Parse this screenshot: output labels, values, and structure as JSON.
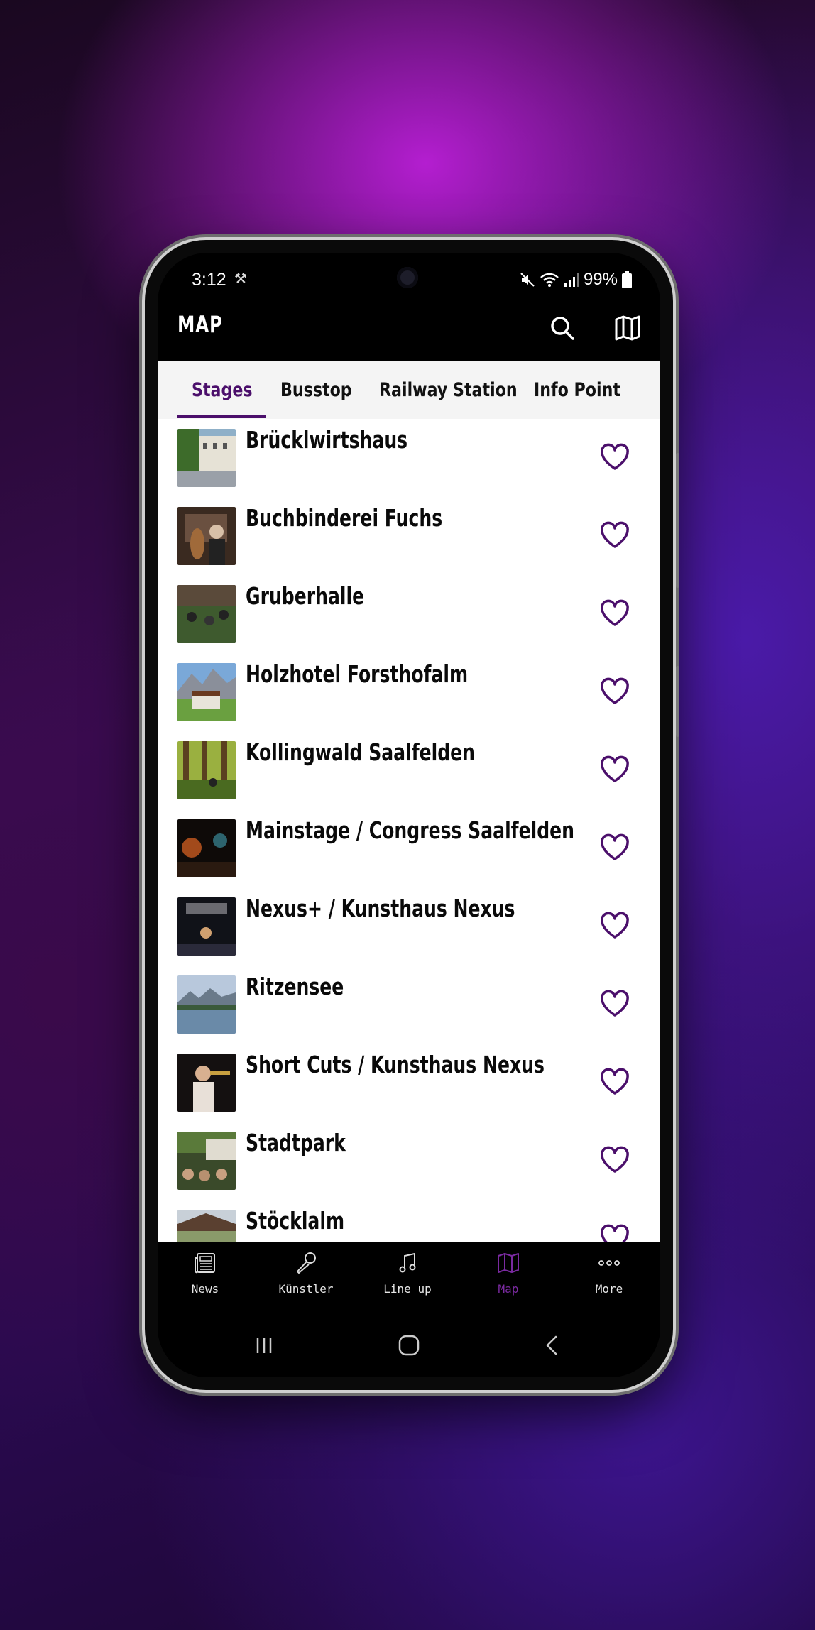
{
  "status": {
    "time": "3:12",
    "battery": "99%"
  },
  "appbar": {
    "title": "MAP"
  },
  "tabs": [
    {
      "label": "Stages",
      "active": true
    },
    {
      "label": "Busstop",
      "active": false
    },
    {
      "label": "Railway Station",
      "active": false
    },
    {
      "label": "Info Point",
      "active": false
    }
  ],
  "stages": [
    {
      "name": "Brücklwirtshaus"
    },
    {
      "name": "Buchbinderei Fuchs"
    },
    {
      "name": "Gruberhalle"
    },
    {
      "name": "Holzhotel Forsthofalm"
    },
    {
      "name": "Kollingwald Saalfelden"
    },
    {
      "name": "Mainstage / Congress Saalfelden"
    },
    {
      "name": "Nexus+ / Kunsthaus Nexus"
    },
    {
      "name": "Ritzensee"
    },
    {
      "name": "Short Cuts / Kunsthaus Nexus"
    },
    {
      "name": "Stadtpark"
    },
    {
      "name": "Stöcklalm"
    }
  ],
  "bottom_nav": [
    {
      "label": "News",
      "icon": "newspaper-icon"
    },
    {
      "label": "Künstler",
      "icon": "microphone-icon"
    },
    {
      "label": "Line up",
      "icon": "music-note-icon"
    },
    {
      "label": "Map",
      "icon": "map-icon",
      "active": true
    },
    {
      "label": "More",
      "icon": "more-dots-icon"
    }
  ],
  "colors": {
    "accent": "#4b0f6b",
    "nav_active": "#7a2aa0",
    "background": "#000000"
  }
}
